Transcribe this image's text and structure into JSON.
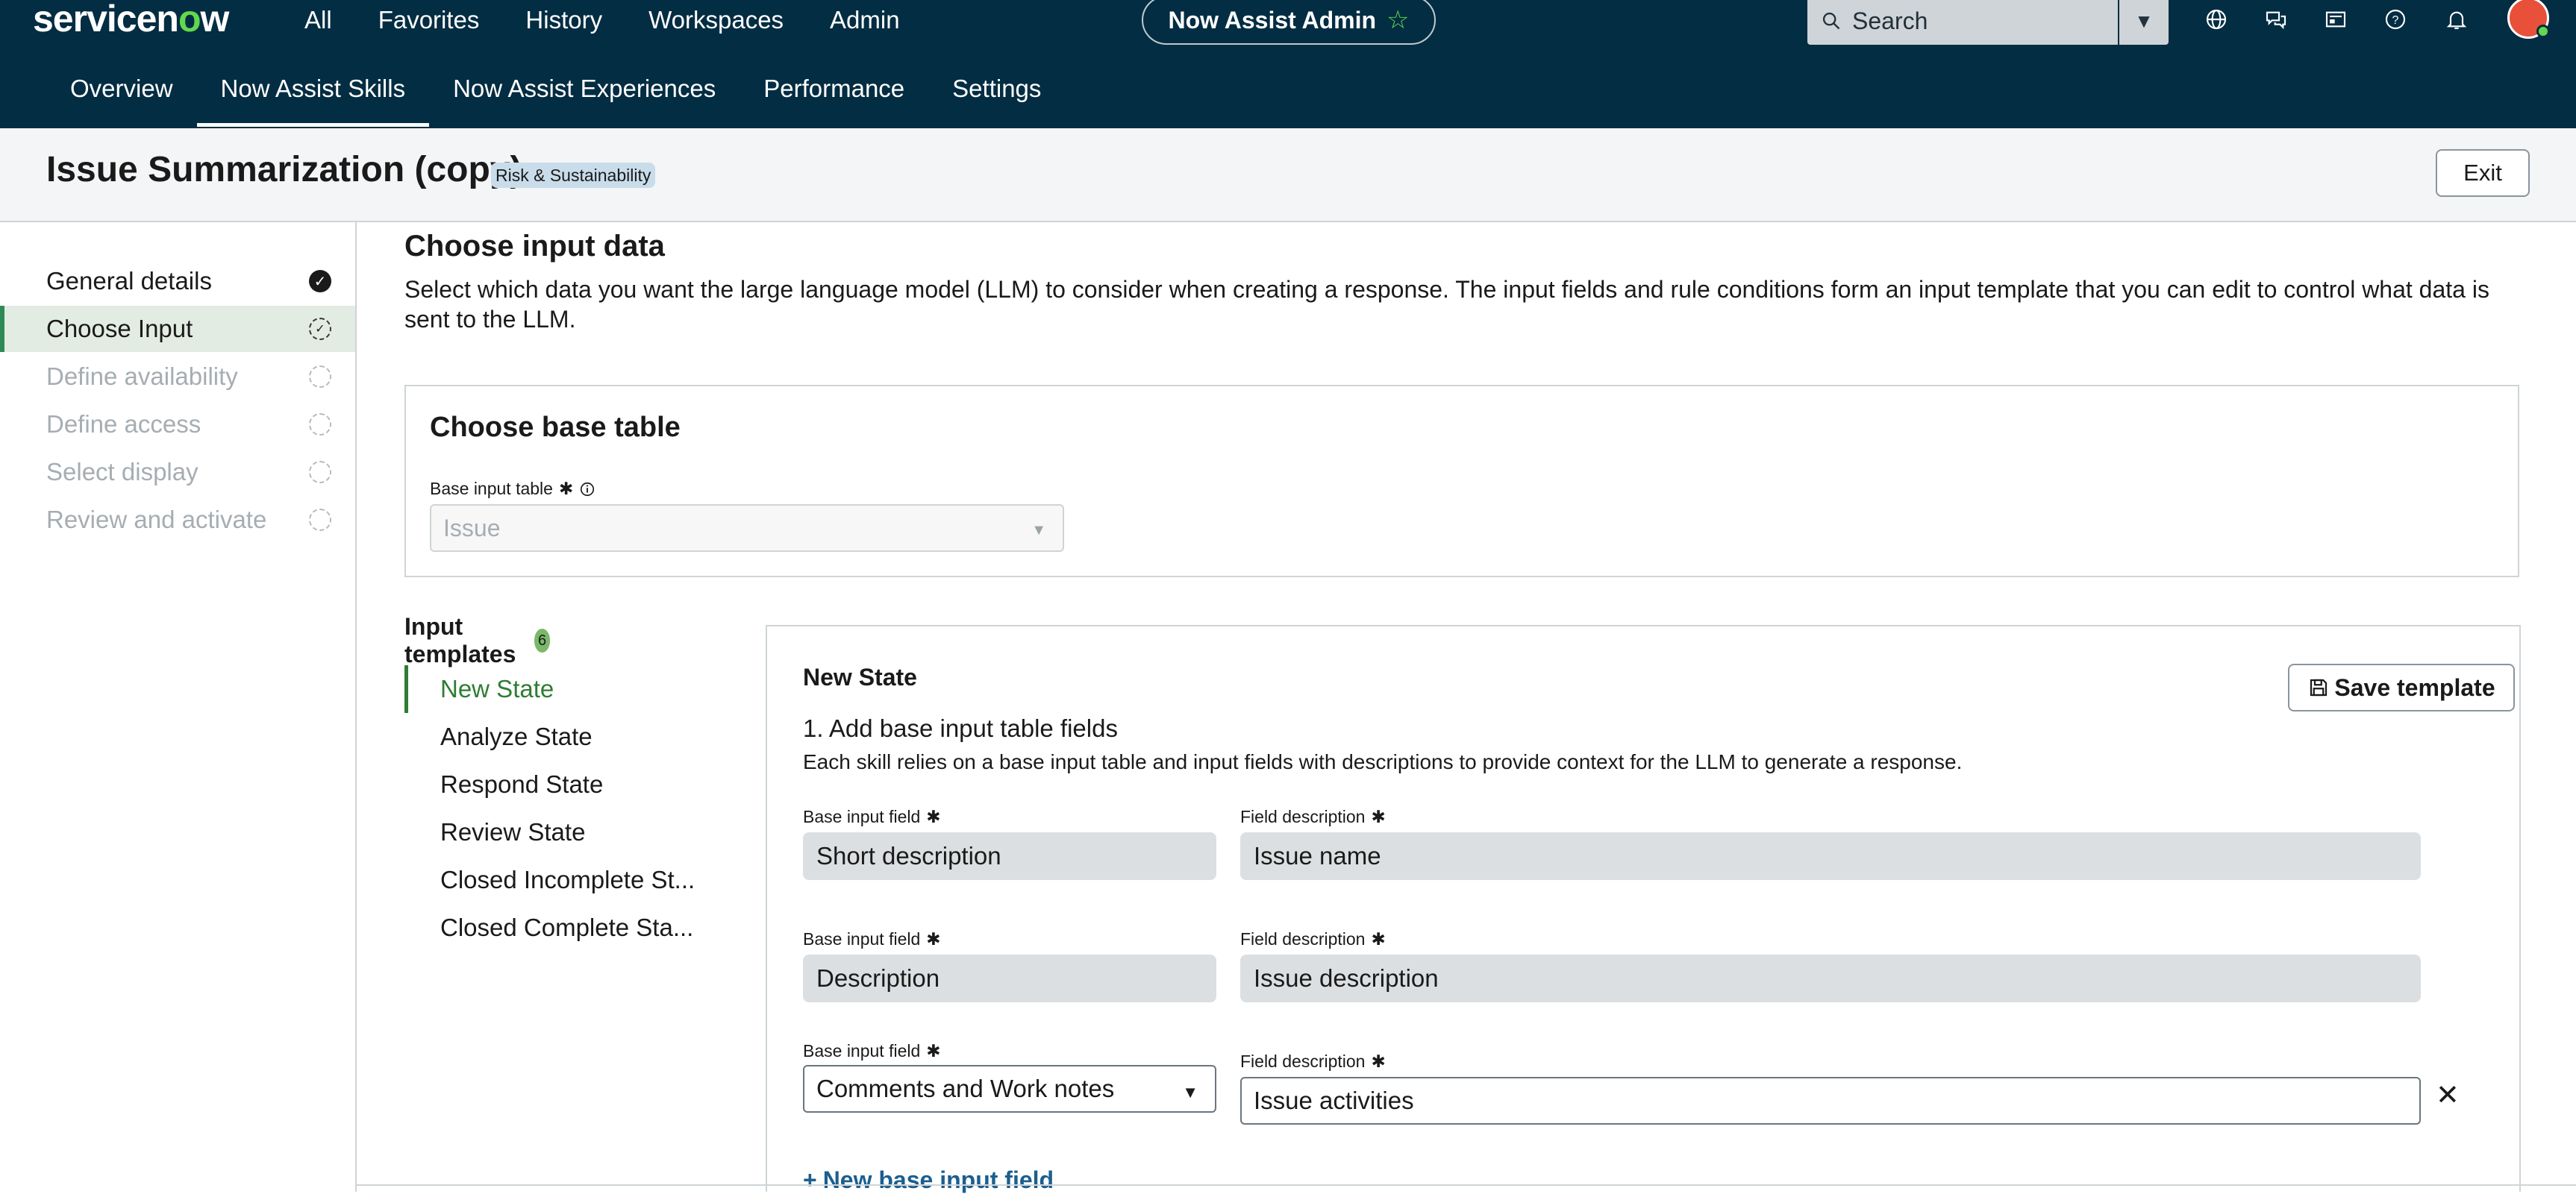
{
  "topbar": {
    "logo": "servicenow",
    "nav": [
      "All",
      "Favorites",
      "History",
      "Workspaces",
      "Admin"
    ],
    "app_pill": "Now Assist Admin",
    "search_placeholder": "Search",
    "tabs": [
      {
        "label": "Overview",
        "active": false
      },
      {
        "label": "Now Assist Skills",
        "active": true
      },
      {
        "label": "Now Assist Experiences",
        "active": false
      },
      {
        "label": "Performance",
        "active": false
      },
      {
        "label": "Settings",
        "active": false
      }
    ],
    "icons": [
      "globe-icon",
      "chat-icon",
      "news-icon",
      "help-icon",
      "bell-icon"
    ]
  },
  "header": {
    "title": "Issue Summarization (copy)",
    "badge": "Risk & Sustainability",
    "exit_label": "Exit"
  },
  "sidebar": {
    "items": [
      {
        "label": "General details",
        "state": "done"
      },
      {
        "label": "Choose Input",
        "state": "active"
      },
      {
        "label": "Define availability",
        "state": "disabled"
      },
      {
        "label": "Define access",
        "state": "disabled"
      },
      {
        "label": "Select display",
        "state": "disabled"
      },
      {
        "label": "Review and activate",
        "state": "disabled"
      }
    ]
  },
  "main": {
    "title": "Choose input data",
    "description": "Select which data you want the large language model (LLM) to consider when creating a response. The input fields and rule conditions form an input template that you can edit to control what data is sent to the LLM.",
    "base_table": {
      "title": "Choose base table",
      "label": "Base input table",
      "value": "Issue"
    },
    "templates": {
      "title": "Input templates",
      "count": "6",
      "items": [
        "New State",
        "Analyze State",
        "Respond State",
        "Review State",
        "Closed Incomplete St...",
        "Closed Complete Sta..."
      ]
    },
    "editor": {
      "title": "New State",
      "save_label": "Save template",
      "section_title": "1. Add base input table fields",
      "section_desc": "Each skill relies on a base input table and input fields with descriptions to provide context for the LLM to generate a response.",
      "field_label": "Base input field",
      "desc_label": "Field description",
      "rows": [
        {
          "field": "Short description",
          "description": "Issue name"
        },
        {
          "field": "Description",
          "description": "Issue description"
        },
        {
          "field": "Comments and Work notes",
          "description": "Issue activities"
        }
      ],
      "new_field_label": "New base input field"
    }
  },
  "colors": {
    "topbar": "#032d42",
    "accent_green": "#62d84e",
    "active_green": "#2e7d32",
    "link_blue": "#1c5e8f"
  }
}
